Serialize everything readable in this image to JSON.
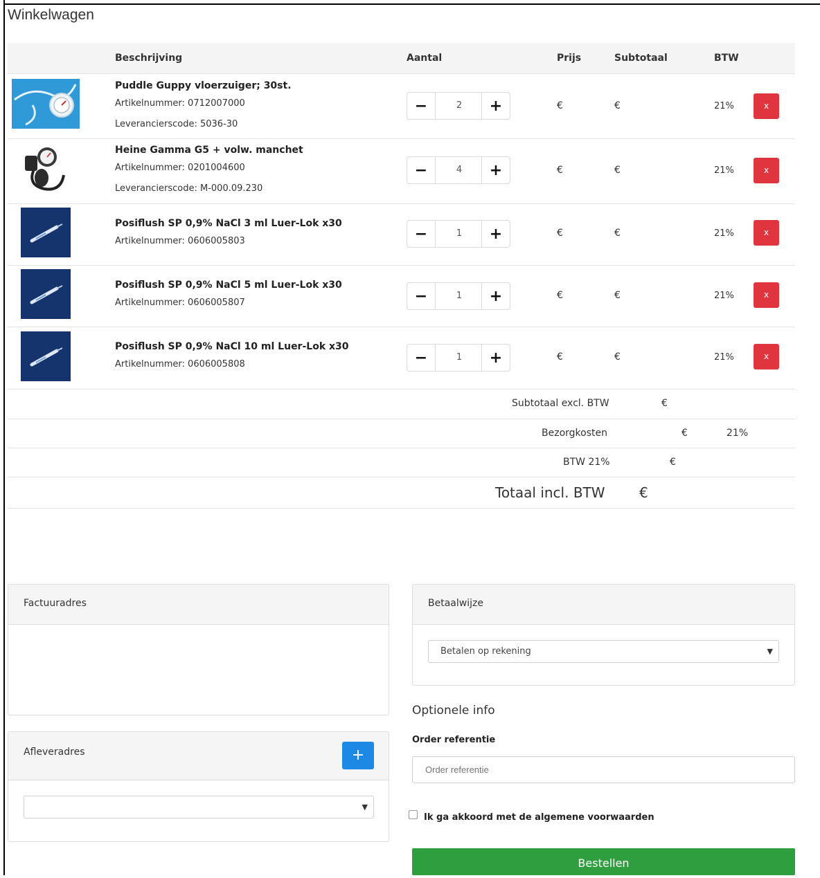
{
  "page": {
    "title": "Winkelwagen"
  },
  "cart": {
    "headers": {
      "description": "Beschrijving",
      "quantity": "Aantal",
      "price": "Prijs",
      "subtotal": "Subtotaal",
      "vat": "BTW"
    },
    "items": [
      {
        "name": "Puddle Guppy vloerzuiger; 30st.",
        "article": "Artikelnummer: 0712007000",
        "supplier": "Leverancierscode: 5036-30",
        "qty": "2",
        "price": "€",
        "subtotal": "€",
        "vat": "21%",
        "remove": "x"
      },
      {
        "name": "Heine Gamma G5 + volw. manchet",
        "article": "Artikelnummer: 0201004600",
        "supplier": "Leverancierscode: M-000.09.230",
        "qty": "4",
        "price": "€",
        "subtotal": "€",
        "vat": "21%",
        "remove": "x"
      },
      {
        "name": "Posiflush SP 0,9% NaCl 3 ml Luer-Lok x30",
        "article": "Artikelnummer: 0606005803",
        "qty": "1",
        "price": "€",
        "subtotal": "€",
        "vat": "21%",
        "remove": "x"
      },
      {
        "name": "Posiflush SP 0,9% NaCl 5 ml Luer-Lok x30",
        "article": "Artikelnummer: 0606005807",
        "qty": "1",
        "price": "€",
        "subtotal": "€",
        "vat": "21%",
        "remove": "x"
      },
      {
        "name": "Posiflush SP 0,9% NaCl 10 ml Luer-Lok x30",
        "article": "Artikelnummer: 0606005808",
        "qty": "1",
        "price": "€",
        "subtotal": "€",
        "vat": "21%",
        "remove": "x"
      }
    ],
    "qty_minus": "−",
    "qty_plus": "+"
  },
  "totals": {
    "subtotal_label": "Subtotaal excl. BTW",
    "subtotal_value": "€",
    "shipping_label": "Bezorgkosten",
    "shipping_value": "€",
    "shipping_vat": "21%",
    "vat_label": "BTW 21%",
    "vat_value": "€",
    "total_label": "Totaal incl. BTW",
    "total_value": "€"
  },
  "billing": {
    "title": "Factuuradres"
  },
  "delivery": {
    "title": "Afleveradres",
    "add_label": "+",
    "selected": ""
  },
  "payment": {
    "title": "Betaalwijze",
    "selected": "Betalen op rekening"
  },
  "optional": {
    "title": "Optionele info",
    "reference_label": "Order referentie",
    "reference_placeholder": "Order referentie",
    "terms_label": "Ik ga akkoord met de algemene voorwaarden",
    "submit_label": "Bestellen"
  },
  "icons": {
    "caret": "caret-down-icon",
    "remove": "remove-icon",
    "plus": "plus-icon",
    "minus": "minus-icon"
  },
  "colors": {
    "remove": "#e0343f",
    "primary": "#1e88e5",
    "success": "#2e9e3f"
  }
}
